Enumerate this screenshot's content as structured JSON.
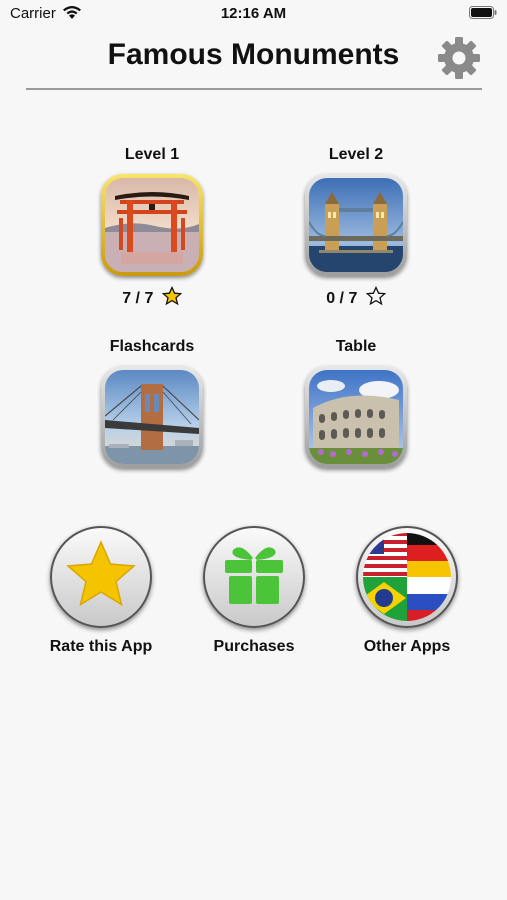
{
  "status": {
    "carrier": "Carrier",
    "time": "12:16 AM"
  },
  "header": {
    "title": "Famous Monuments"
  },
  "tiles": [
    {
      "label": "Level 1",
      "score": "7 / 7",
      "star": "filled-star-icon",
      "image": "torii-gate-image"
    },
    {
      "label": "Level 2",
      "score": "0 / 7",
      "star": "empty-star-icon",
      "image": "tower-bridge-image"
    },
    {
      "label": "Flashcards",
      "image": "brooklyn-bridge-image"
    },
    {
      "label": "Table",
      "image": "colosseum-image"
    }
  ],
  "actions": [
    {
      "label": "Rate this App",
      "icon": "star-icon"
    },
    {
      "label": "Purchases",
      "icon": "gift-icon"
    },
    {
      "label": "Other Apps",
      "icon": "flags-icon"
    }
  ],
  "colors": {
    "gold": "#f5c400",
    "gift_green": "#4cc43a",
    "divider": "#9a9a9a"
  }
}
